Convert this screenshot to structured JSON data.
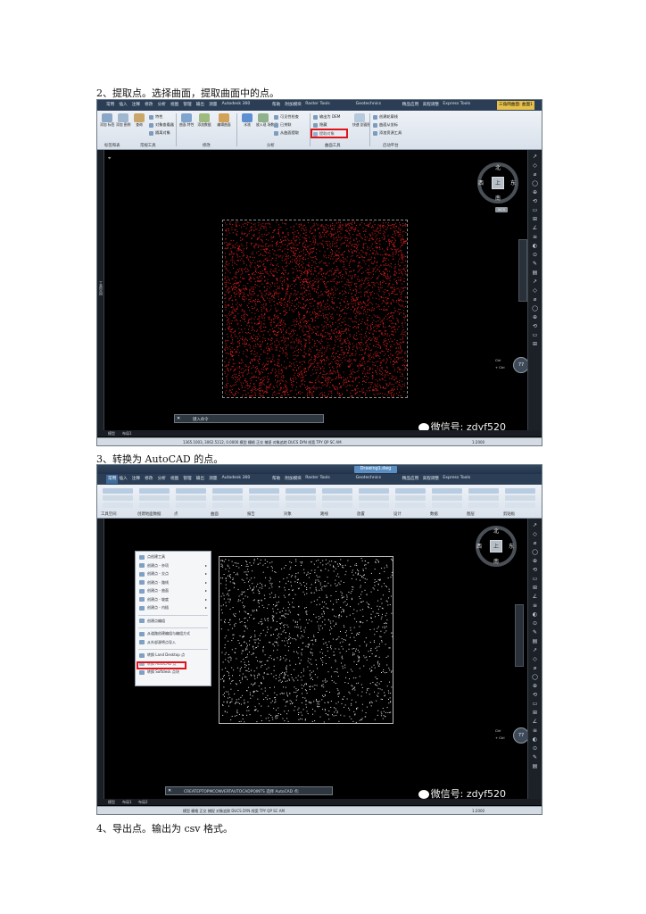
{
  "captions": {
    "step2": "2、提取点。选择曲面，提取曲面中的点。",
    "step3": "3、转换为 AutoCAD 的点。",
    "step4": "4、导出点。输出为 csv 格式。"
  },
  "shot1": {
    "tabs": [
      "常用",
      "插入",
      "注释",
      "修改",
      "分析",
      "视图",
      "管理",
      "输出",
      "测量",
      "Autodesk 360",
      "帮助",
      "附加模块",
      "Raster Tools",
      "Geotechnics",
      "精品应用",
      "高程调整",
      "Express Tools",
      "三角网曲面: 曲面1"
    ],
    "buttons": [
      {
        "label": "添加\n标签"
      },
      {
        "label": "添加\n图例"
      },
      {
        "label": "查询"
      },
      {
        "label": "曲面\n特性"
      },
      {
        "label": "添加数据"
      },
      {
        "label": "编辑曲面"
      },
      {
        "label": "水流"
      },
      {
        "label": "放入现\n场数据"
      },
      {
        "label": "快速\n剖面图"
      }
    ],
    "small_items": [
      "特性",
      "对象查看器",
      "隔离对象",
      "可见性检查",
      "已关联",
      "从曲面提取",
      "输出为 DEM",
      "隐藏",
      "提取对象",
      "创建轮廓线",
      "曲面从坐标",
      "添加资源工具"
    ],
    "highlighted_item": "提取对象",
    "panels": [
      "标签和表",
      "常规工具",
      "修改",
      "分析",
      "曲面工具",
      "启动平台"
    ],
    "viewcube": {
      "north": "北",
      "south": "南",
      "west": "西",
      "east": "东",
      "face": "上",
      "wcs": "WCS"
    },
    "left_strip": "工具空间",
    "navwheel_labels": [
      "Ctrl",
      "+ Ctrl"
    ],
    "navwheel_value": "77",
    "command_prompt": "键入命令",
    "layout_tabs": [
      "模型",
      "布局1"
    ],
    "status_text": "1365.1003, 3062.5112, 0.0000  模型  栅格  正交  捕捉  对象追踪  DUCS  DYN  线宽  TPY  QP  SC  AM",
    "status_right": "1:2000",
    "watermark": "微信号: zdyf520",
    "point_color": "#d11e20"
  },
  "shot2": {
    "window_title": "Drawing1.dwg",
    "tabs": [
      "常用",
      "插入",
      "注释",
      "修改",
      "分析",
      "视图",
      "管理",
      "输出",
      "测量",
      "Autodesk 360",
      "帮助",
      "附加模块",
      "Raster Tools",
      "Geotechnics",
      "精品应用",
      "高程调整",
      "Express Tools"
    ],
    "toolbar_groups": [
      "工具空间",
      "创建地面数据",
      "点",
      "曲面",
      "报告",
      "对象",
      "路线",
      "放置",
      "设计",
      "数据",
      "图层",
      "剪贴板"
    ],
    "dropdown": {
      "items": [
        "点创建工具",
        "创建点 - 杂项",
        "创建点 - 交点",
        "创建点 - 路线",
        "创建点 - 曲面",
        "创建点 - 坡度",
        "创建点 - 内插",
        "创建点编组",
        "从道路创建编组与编组方式",
        "从外部源将点导入",
        "转换 Land Desktop 点",
        "转换 AutoCAD 点",
        "转换 Softdesk 点块"
      ],
      "highlighted": "转换 AutoCAD 点"
    },
    "viewcube": {
      "north": "北",
      "south": "南",
      "west": "西",
      "east": "东",
      "face": "上",
      "wcs": "WCS"
    },
    "navwheel_labels": [
      "Ctrl",
      "+ Ctrl"
    ],
    "navwheel_value": "77",
    "command_text": "CREATEPTOPMCONVERTAUTOCADPOINTS 选择 AutoCAD 点:",
    "layout_tabs": [
      "模型",
      "布局1",
      "布局2"
    ],
    "status_text": "模型  栅格  正交  捕捉  对象追踪  DUCS  DYN  线宽  TPY  QP  SC  AM",
    "status_right": "1:2000",
    "watermark": "微信号: zdyf520",
    "point_color": "#e8e8e8"
  }
}
